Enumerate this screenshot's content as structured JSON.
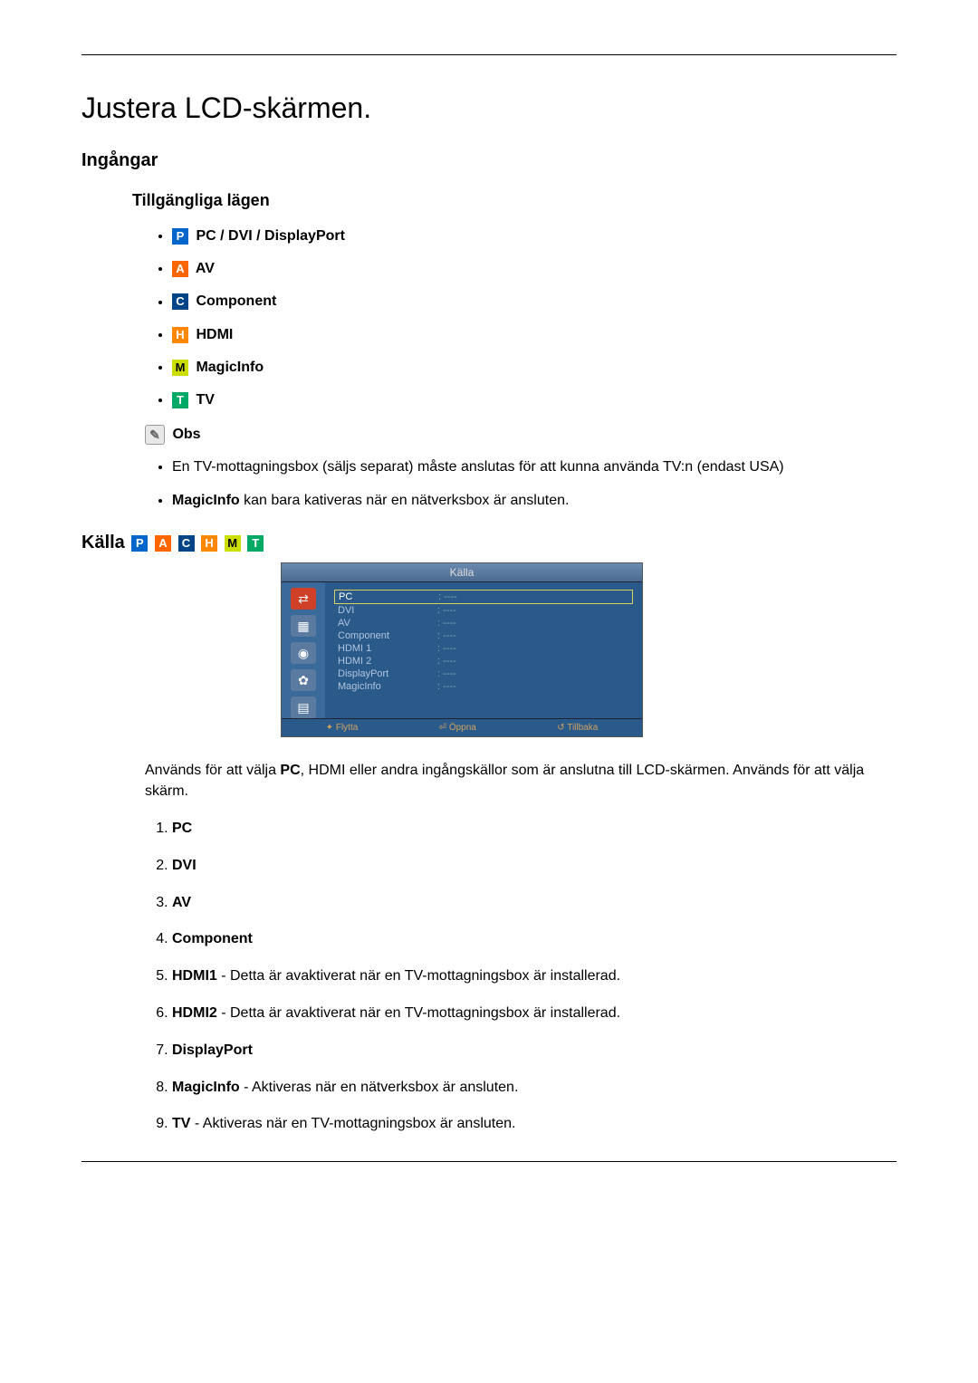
{
  "title": "Justera LCD-skärmen.",
  "section_inputs": "Ingångar",
  "subsection_modes": "Tillgängliga lägen",
  "modes": {
    "p": {
      "letter": "P",
      "label": "PC / DVI / DisplayPort"
    },
    "a": {
      "letter": "A",
      "label": "AV"
    },
    "c": {
      "letter": "C",
      "label": "Component"
    },
    "h": {
      "letter": "H",
      "label": "HDMI"
    },
    "m": {
      "letter": "M",
      "label": "MagicInfo"
    },
    "t": {
      "letter": "T",
      "label": "TV"
    }
  },
  "note_label": "Obs",
  "notes": {
    "n1": "En TV-mottagningsbox (säljs separat) måste anslutas för att kunna använda TV:n (endast USA)",
    "n2_bold": "MagicInfo",
    "n2_rest": " kan bara kativeras när en nätverksbox är ansluten."
  },
  "kalla_heading": "Källa",
  "osd": {
    "title": "Källa",
    "rows": {
      "r1": {
        "label": "PC",
        "value": ": ----"
      },
      "r2": {
        "label": "DVI",
        "value": ": ----"
      },
      "r3": {
        "label": "AV",
        "value": ": ----"
      },
      "r4": {
        "label": "Component",
        "value": ": ----"
      },
      "r5": {
        "label": "HDMI 1",
        "value": ": ----"
      },
      "r6": {
        "label": "HDMI 2",
        "value": ": ----"
      },
      "r7": {
        "label": "DisplayPort",
        "value": ": ----"
      },
      "r8": {
        "label": "MagicInfo",
        "value": ": ----"
      }
    },
    "footer": {
      "f1": "Flytta",
      "f2": "Öppna",
      "f3": "Tillbaka"
    }
  },
  "desc_pre": "Används för att välja ",
  "desc_bold": "PC",
  "desc_post": ", HDMI eller andra ingångskällor som är anslutna till LCD-skärmen. Används för att välja skärm.",
  "list": {
    "i1": "PC",
    "i2": "DVI",
    "i3": "AV",
    "i4": "Component",
    "i5b": "HDMI1",
    "i5r": " - Detta är avaktiverat när en TV-mottagningsbox är installerad.",
    "i6b": "HDMI2",
    "i6r": " - Detta är avaktiverat när en TV-mottagningsbox är installerad.",
    "i7": "DisplayPort",
    "i8b": "MagicInfo",
    "i8r": " - Aktiveras när en nätverksbox är ansluten.",
    "i9b": "TV",
    "i9r": " - Aktiveras när en TV-mottagningsbox är ansluten."
  }
}
